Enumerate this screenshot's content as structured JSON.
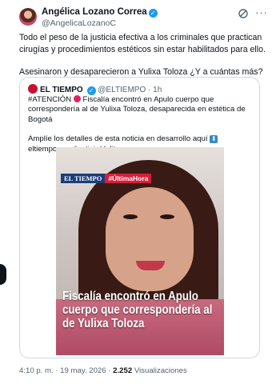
{
  "author": {
    "name": "Angélica Lozano Correa",
    "handle": "@AngelicaLozanoC",
    "verified_mark": "✓"
  },
  "header_icons": [
    "grok-icon",
    "more-options-icon"
  ],
  "more_label": "···",
  "post_text": [
    "Todo el peso de la justicia efectiva a los criminales que practican cirugías y procedimientos estéticos sin estar habilitados para ello.",
    "Asesinaron y desaparecieron a Yulixa Toloza ¿Y a cuántas más?"
  ],
  "quote": {
    "name": "EL TIEMPO",
    "handle": "@ELTIEMPO",
    "time": "· 1h",
    "verified_mark": "✓",
    "text_line1_prefix": "#ATENCIÓN",
    "text_line1_rest": "Fiscalía encontró en Apulo cuerpo que correspondería al de Yulixa Toloza, desaparecida en estética de Bogotá",
    "text_line2": "Amplíe los detalles de esta noticia en desarrollo aquí",
    "link": "eltiempo.com/justicia/delit...",
    "media": {
      "brand": "EL TIEMPO",
      "hashtag": "#ÚltimaHora",
      "headline": "Fiscalía encontró en Apulo cuerpo que correspondería al de Yulixa Toloza"
    }
  },
  "footer": {
    "time": "4:10 p. m. · 19 may. 2026 ·",
    "views_count": "2.252",
    "views_label": "Visualizaciones"
  },
  "colors": {
    "accent": "#1d9bf0",
    "brand_red": "#d81e3a",
    "brand_blue": "#1a3d7a"
  }
}
